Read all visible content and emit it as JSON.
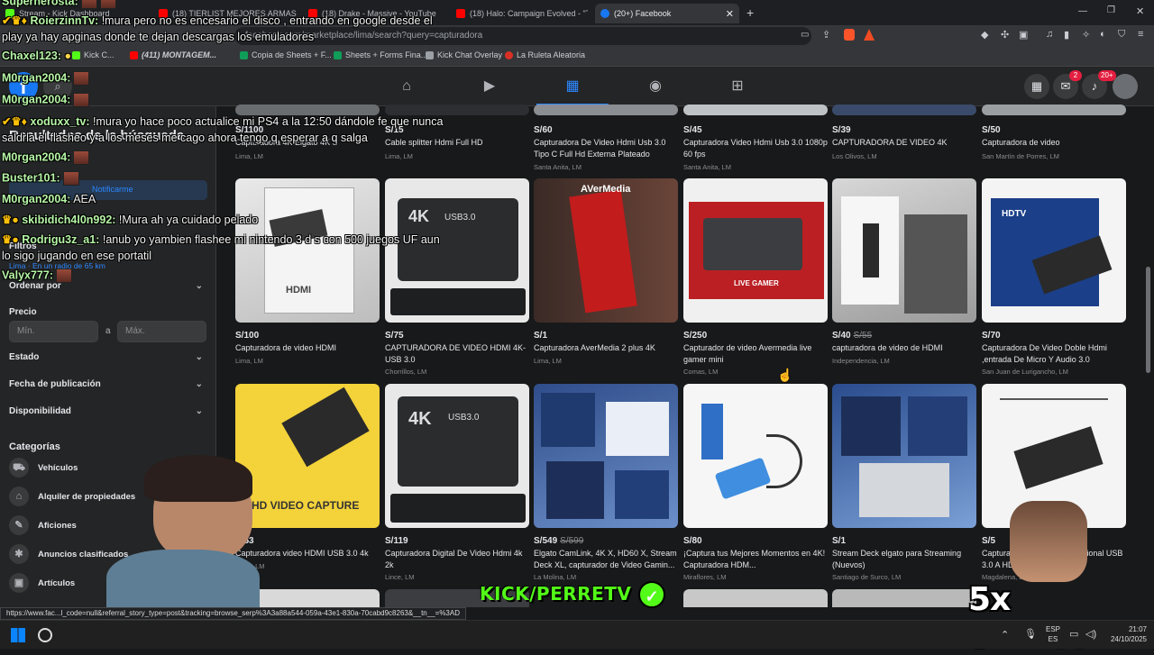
{
  "browser": {
    "tabs": [
      {
        "label": "Stream - Kick Dashboard",
        "color": "#53fc18"
      },
      {
        "label": "(18) TIERLIST MEJORES ARMAS (",
        "color": "#ff0000"
      },
      {
        "label": "(18) Drake - Massive - YouTube",
        "color": "#ff0000"
      },
      {
        "label": "(18) Halo: Campaign Evolved - \"The",
        "color": "#ff0000"
      },
      {
        "label": "(20+) Facebook",
        "color": "#1877f2"
      }
    ],
    "url": "facebook.com/marketplace/lima/search?query=capturadora",
    "bookmarks": [
      {
        "label": "Kick C...",
        "color": "#53fc18"
      },
      {
        "label": "(411) MONTAGEM...",
        "color": "#ff0000"
      },
      {
        "label": "Copia de Sheets + F...",
        "color": "#0f9d58"
      },
      {
        "label": "Sheets + Forms Fina...",
        "color": "#0f9d58"
      },
      {
        "label": "Kick Chat Overlay",
        "color": "#9aa0a6"
      },
      {
        "label": "La Ruleta Aleatoria",
        "color": "#d93025"
      }
    ]
  },
  "facebook": {
    "badges": {
      "messenger": "2",
      "notifications": "20+"
    }
  },
  "sidebar": {
    "results_title": "Resultados de la búsqueda",
    "notify_label": "Notificarme",
    "filters_title": "Filtros",
    "location": "Lima · En un radio de 65 km",
    "sort_label": "Ordenar por",
    "price_label": "Precio",
    "price_min_placeholder": "Mín.",
    "price_sep": "a",
    "price_max_placeholder": "Máx.",
    "state_label": "Estado",
    "date_label": "Fecha de publicación",
    "availability_label": "Disponibilidad",
    "categories_title": "Categorías",
    "categories": [
      {
        "label": "Vehículos",
        "icon": "car-icon"
      },
      {
        "label": "Alquiler de propiedades",
        "icon": "home-icon"
      },
      {
        "label": "Aficiones",
        "icon": "brush-icon"
      },
      {
        "label": "Anuncios clasificados",
        "icon": "tag-icon"
      },
      {
        "label": "Artículos",
        "icon": "box-icon"
      }
    ]
  },
  "listings": [
    {
      "price": "S/1100",
      "old": "",
      "title": "Capturadora 4K Elgato 4K S",
      "loc": "Lima, LM"
    },
    {
      "price": "S/15",
      "old": "",
      "title": "Cable splitter Hdmi Full HD",
      "loc": "Lima, LM"
    },
    {
      "price": "S/60",
      "old": "",
      "title": "Capturadora De Video Hdmi Usb 3.0 Tipo C Full Hd Externa Plateado",
      "loc": "Santa Anita, LM"
    },
    {
      "price": "S/45",
      "old": "",
      "title": "Capturadora Video Hdmi Usb 3.0 1080p 60 fps",
      "loc": "Santa Anita, LM"
    },
    {
      "price": "S/39",
      "old": "",
      "title": "CAPTURADORA DE VIDEO 4K",
      "loc": "Los Olivos, LM"
    },
    {
      "price": "S/50",
      "old": "",
      "title": "Capturadora de video",
      "loc": "San Martín de Porres, LM"
    },
    {
      "price": "S/100",
      "old": "",
      "title": "Capturadora de video HDMI",
      "loc": "Lima, LM"
    },
    {
      "price": "S/75",
      "old": "",
      "title": "CAPTURADORA DE VIDEO HDMI 4K-USB 3.0",
      "loc": "Chorrillos, LM"
    },
    {
      "price": "S/1",
      "old": "",
      "title": "Capturadora AverMedia 2 plus 4K",
      "loc": "Lima, LM"
    },
    {
      "price": "S/250",
      "old": "",
      "title": "Capturador de video Avermedia live gamer mini",
      "loc": "Comas, LM"
    },
    {
      "price": "S/40",
      "old": "S/55",
      "title": "capturadora de video de HDMI",
      "loc": "Independencia, LM"
    },
    {
      "price": "S/70",
      "old": "",
      "title": "Capturadora De Video Doble Hdmi ,entrada De Micro Y Audio 3.0",
      "loc": "San Juan de Lurigancho, LM"
    },
    {
      "price": "S/53",
      "old": "",
      "title": "Capturadora video HDMI USB 3.0 4k",
      "loc": "Lince, LM"
    },
    {
      "price": "S/119",
      "old": "",
      "title": "Capturadora Digital De Video Hdmi 4k 2k",
      "loc": "Lince, LM"
    },
    {
      "price": "S/549",
      "old": "S/599",
      "title": "Elgato CamLink, 4K X, HD60 X, Stream Deck XL, capturador de Video Gamin...",
      "loc": "La Molina, LM"
    },
    {
      "price": "S/80",
      "old": "",
      "title": "¡Captura tus Mejores Momentos en 4K! Capturadora HDM...",
      "loc": "Miraflores, LM"
    },
    {
      "price": "S/1",
      "old": "",
      "title": "Stream Deck elgato para Streaming (Nuevos)",
      "loc": "Santiago de Surco, LM"
    },
    {
      "price": "S/5",
      "old": "",
      "title": "Capturadora de Video Profesional USB 3.0 A HDMI",
      "loc": "Magdalena, LM"
    }
  ],
  "chat": [
    {
      "user": "Superherosta:",
      "msg": ""
    },
    {
      "user": "RoierzinnTv:",
      "msg": " !mura pero no es encesario el disco , entrando en google desde el"
    },
    {
      "user": "",
      "msg": "play ya hay apginas donde te dejan descargas los emuladores"
    },
    {
      "user": "Chaxel123:",
      "msg": ""
    },
    {
      "user": "M0rgan2004:",
      "msg": ""
    },
    {
      "user": "M0rgan2004:",
      "msg": ""
    },
    {
      "user": "xoduxx_tv:",
      "msg": " !mura yo hace poco actualice mi PS4 a la 12:50 dándole fe que nunca"
    },
    {
      "user": "",
      "msg": "saldria el flasheo y a los meses me cago ahora tengo q esperar a q salga"
    },
    {
      "user": "M0rgan2004:",
      "msg": ""
    },
    {
      "user": "Buster101:",
      "msg": ""
    },
    {
      "user": "M0rgan2004:",
      "msg": " AEA"
    },
    {
      "user": "skibidich4l0n992:",
      "msg": " !Mura ah ya cuidado pelado"
    },
    {
      "user": "Rodrigu3z_a1:",
      "msg": " !anub yo yambien flashee mi nintendo 3 d s con 500 juegos UF aun"
    },
    {
      "user": "",
      "msg": "lo sigo jugando en ese portatil"
    },
    {
      "user": "Valyx777:",
      "msg": ""
    }
  ],
  "overlay": {
    "kick_logo": "KICK/PERRETV",
    "streak": "5x STREAK"
  },
  "status_url": "https://www.fac...l_code=null&referral_story_type=post&tracking=browse_serp%3A3a88a544-059a-43e1-830a-70cabd9c8263&__tn__=%3AD",
  "taskbar": {
    "lang": "ESP",
    "lang2": "ES",
    "time": "21:07",
    "date": "24/10/2025"
  }
}
